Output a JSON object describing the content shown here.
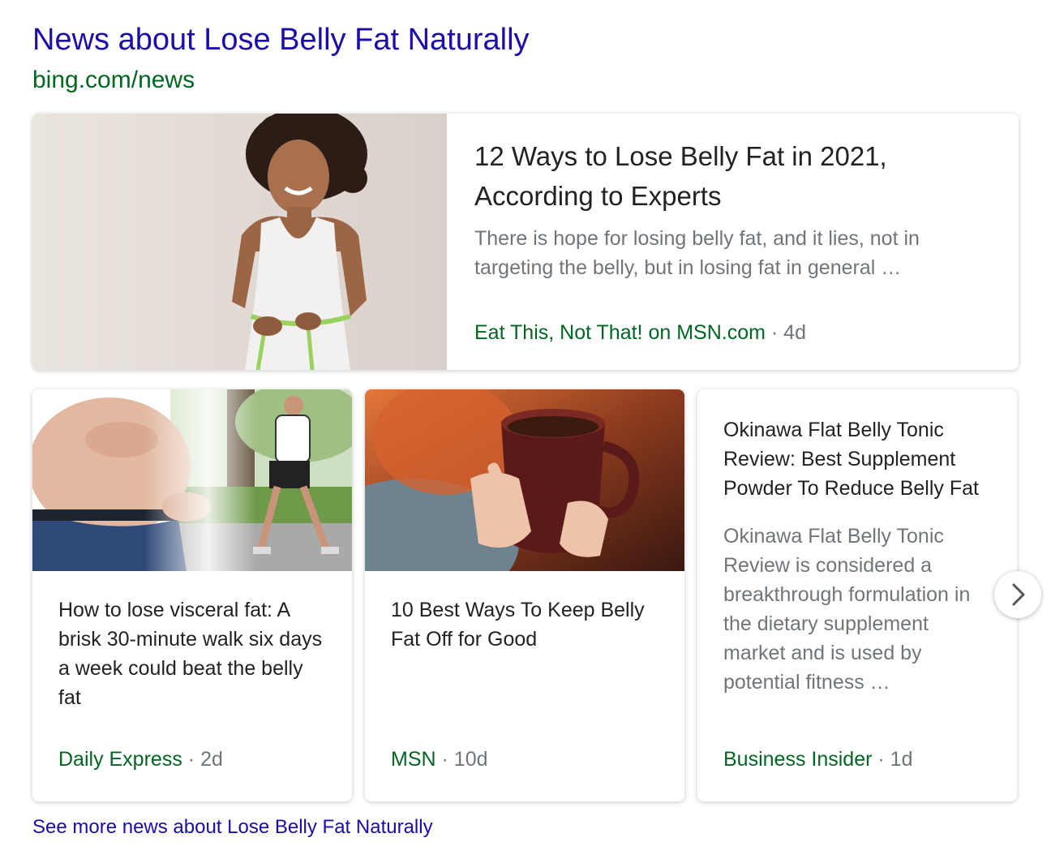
{
  "header": {
    "title": "News about Lose Belly Fat Naturally",
    "url": "bing.com/news"
  },
  "featured": {
    "headline": "12 Ways to Lose Belly Fat in 2021, According to Experts",
    "snippet": "There is hope for losing belly fat, and it lies, not in targeting the belly, but in losing fat in general …",
    "source": "Eat This, Not That! on MSN.com",
    "separator": "·",
    "age": "4d",
    "image_icon": "woman-measuring-waist-image"
  },
  "cards": [
    {
      "headline": "How to lose visceral fat: A brisk 30-minute walk six days a week could beat the belly fat",
      "source": "Daily Express",
      "separator": "·",
      "age": "2d",
      "image_icon": "belly-and-walking-man-image"
    },
    {
      "headline": "10 Best Ways To Keep Belly Fat Off for Good",
      "source": "MSN",
      "separator": "·",
      "age": "10d",
      "image_icon": "hands-holding-tea-cup-image"
    },
    {
      "headline": "Okinawa Flat Belly Tonic Review: Best Supplement Powder To Reduce Belly Fat",
      "snippet": "Okinawa Flat Belly Tonic Review is considered a breakthrough formulation in the dietary supplement market and is used by potential fitness …",
      "source": "Business Insider",
      "separator": "·",
      "age": "1d"
    }
  ],
  "carousel": {
    "next_icon": "chevron-right-icon"
  },
  "footer": {
    "see_more": "See more news about Lose Belly Fat Naturally"
  },
  "colors": {
    "link": "#1a0dab",
    "source": "#006621",
    "meta": "#70757a",
    "text": "#222222"
  }
}
